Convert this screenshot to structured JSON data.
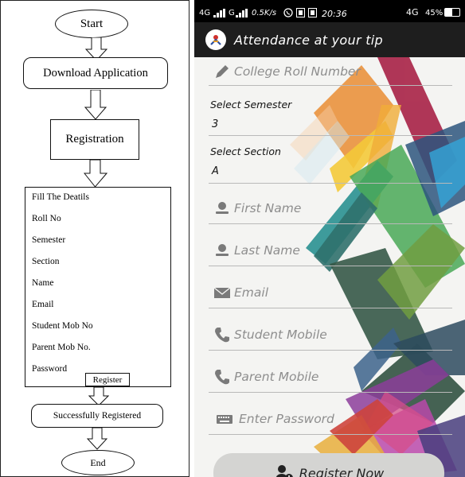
{
  "flowchart": {
    "start": "Start",
    "download": "Download Application",
    "registration": "Registration",
    "details_title": "Fill The Deatils",
    "details": [
      "Roll No",
      "Semester",
      "Section",
      "Name",
      "Email",
      "Student Mob No",
      "Parent Mob No.",
      "Password"
    ],
    "register": "Register",
    "success": "Successfully Registered",
    "end": "End"
  },
  "status_bar": {
    "left": "4G",
    "speed": "0.5K/s",
    "time": "20:36",
    "network": "4G",
    "battery": "45%"
  },
  "app": {
    "title": "Attendance at your tip"
  },
  "form": {
    "roll_placeholder": "College Roll Number",
    "semester_label": "Select Semester",
    "semester_value": "3",
    "section_label": "Select Section",
    "section_value": "A",
    "first_name": "First Name",
    "last_name": "Last Name",
    "email": "Email",
    "student_mobile": "Student Mobile",
    "parent_mobile": "Parent Mobile",
    "password": "Enter Password",
    "register_button": "Register Now"
  },
  "colors": {
    "app_bar": "#1e1e1e",
    "background": "#f4f4f2",
    "hint_text": "#8e8e8e",
    "icon": "#7a7a7a",
    "button": "#d4d4d2"
  }
}
